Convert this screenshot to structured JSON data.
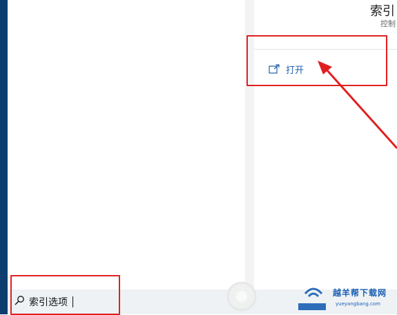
{
  "detail": {
    "title": "索引",
    "subtitle": "控制",
    "open_label": "打开"
  },
  "search": {
    "query": "索引选项"
  },
  "watermark": {
    "title": "越羊帮下载网",
    "url": "yueyangbang.com"
  },
  "colors": {
    "accent": "#0b3d6e",
    "link": "#1f5ea8",
    "annotation": "#e02020"
  },
  "icons": {
    "open": "open-external-icon",
    "search": "search-icon"
  }
}
